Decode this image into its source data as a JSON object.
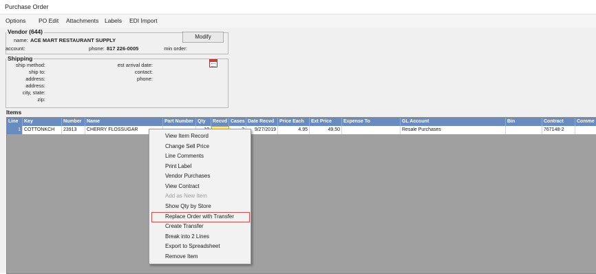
{
  "window": {
    "title": "Purchase Order"
  },
  "menu": [
    "Options",
    "PO Edit",
    "Attachments",
    "Labels",
    "EDI Import"
  ],
  "vendor": {
    "legend": "Vendor (644)",
    "name_label": "name:",
    "name_value": "ACE MART RESTAURANT SUPPLY",
    "account_label": "account:",
    "phone_label": "phone:",
    "phone_value": "817 226-0005",
    "min_order_label": "min order:",
    "modify_button": "Modify"
  },
  "shipping": {
    "legend": "Shipping",
    "ship_method_label": "ship method:",
    "ship_to_label": "ship to:",
    "address_label": "address:",
    "address2_label": "address:",
    "city_state_label": "city, state:",
    "zip_label": "zip:",
    "est_arrival_label": "est arrival date:",
    "contact_label": "contact:",
    "phone_label": "phone:"
  },
  "items": {
    "title": "Items",
    "columns": [
      "Line",
      "Key",
      "Number",
      "Name",
      "Part Number",
      "Qty",
      "Recvd",
      "Cases",
      "Date Recvd",
      "Price Each",
      "Ext Price",
      "Expense To",
      "GL Account",
      "Bin",
      "Contract",
      "Comme"
    ],
    "row": {
      "line": "1",
      "key": "COTTONKCH",
      "number": "23913",
      "name": "CHERRY FLOSSUGAR",
      "part_number": "",
      "qty": "10",
      "recvd": "",
      "cases": "2",
      "date_recvd": "9/27/2019",
      "price_each": "4.95",
      "ext_price": "49.50",
      "expense_to": "",
      "gl_account": "Resale Purchases",
      "bin": "",
      "contract": "767148-2",
      "comments": ""
    }
  },
  "context_menu": {
    "items": [
      {
        "label": "View Item Record",
        "enabled": true
      },
      {
        "label": "Change Sell Price",
        "enabled": true
      },
      {
        "label": "Line Comments",
        "enabled": true
      },
      {
        "label": "Print Label",
        "enabled": true
      },
      {
        "label": "Vendor Purchases",
        "enabled": true
      },
      {
        "label": "View Contract",
        "enabled": true
      },
      {
        "label": "Add as New Item",
        "enabled": false
      },
      {
        "label": "Show Qty by Store",
        "enabled": true
      },
      {
        "label": "Replace Order with Transfer",
        "enabled": true,
        "highlighted": true
      },
      {
        "label": "Create Transfer",
        "enabled": true
      },
      {
        "label": "Break into 2 Lines",
        "enabled": true
      },
      {
        "label": "Export to Spreadsheet",
        "enabled": true
      },
      {
        "label": "Remove Item",
        "enabled": true
      }
    ]
  },
  "colors": {
    "header_blue": "#6a8bbf",
    "grid_background": "#a0a0a0",
    "highlight_border": "#d64a4a",
    "recvd_cell": "#ffe87a"
  }
}
